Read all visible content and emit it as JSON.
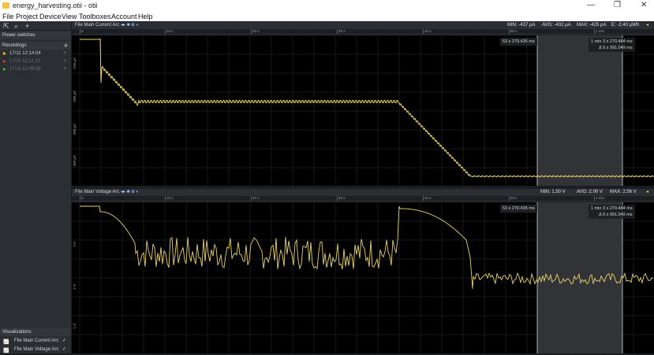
{
  "window": {
    "title": "energy_harvesting.otii - otii",
    "minimize": "—",
    "maximize": "❐",
    "close": "✕"
  },
  "menu": [
    "File",
    "Project",
    "Device",
    "View",
    "Toolboxes",
    "Account",
    "Help"
  ],
  "sidebar": {
    "power_switches": "Power switches",
    "recordings_label": "Recordings",
    "recordings": [
      {
        "name": "17/11 12:14:04",
        "color": "#f3c53a",
        "active": true
      },
      {
        "name": "17/11 12:11:21",
        "color": "#d94040",
        "active": false
      },
      {
        "name": "17/11 12:09:58",
        "color": "#3fbf4f",
        "active": false
      }
    ],
    "visualizations_label": "Visualizations",
    "visualizations": [
      "File Main Current Arc",
      "File Main Voltage Arc"
    ]
  },
  "panels": [
    {
      "name": "File Main Current Arc",
      "stats": {
        "min": "MIN: -437 µA",
        "avg": "AVG: -432 µA",
        "max": "MAX: -425 µA",
        "energy": "E: -2.40 µWh"
      },
      "ticks": [
        "0",
        "10 s",
        "20 s",
        "30 s",
        "40 s",
        "50 s",
        "1 min"
      ],
      "y_labels": [
        "-100 µA",
        "-200 µA",
        "-300 µA",
        "-400 µA"
      ],
      "cursor_time": "53 s 279.435 ms",
      "right_time": "1 min 3 s 270.484 ms",
      "delta": "Δ 9 s 991.049 ms"
    },
    {
      "name": "File Main Voltage Arc",
      "stats": {
        "min": "MIN: 1.50 V",
        "avg": "AVG: 2.00 V",
        "max": "MAX: 2.56 V"
      },
      "ticks": [
        "0",
        "10 s",
        "20 s",
        "30 s",
        "40 s",
        "50 s",
        "1 min"
      ],
      "y_labels": [
        "3 V",
        "2 V",
        "1 V"
      ],
      "cursor_time": "53 s 279.435 ms",
      "right_time": "1 min 3 s 270.484 ms",
      "delta": "Δ 9 s 991.049 ms"
    }
  ],
  "trace_color": "#e8d36a",
  "accent": "#f3c53a"
}
